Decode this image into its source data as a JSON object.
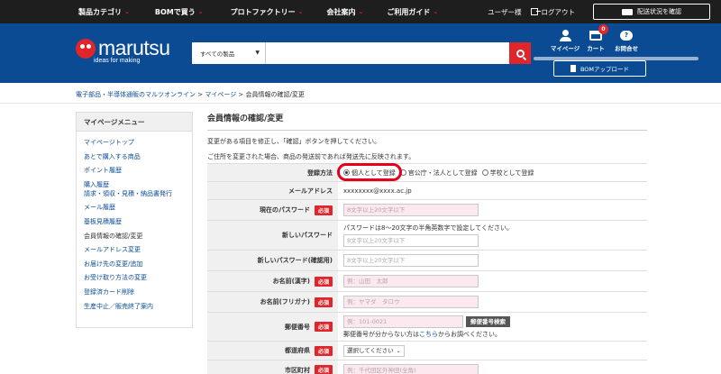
{
  "topbar": {
    "nav": [
      {
        "label": "製品カテゴリ"
      },
      {
        "label": "BOMで買う"
      },
      {
        "label": "プロトファクトリー"
      },
      {
        "label": "会社案内"
      },
      {
        "label": "ご利用ガイド"
      }
    ],
    "user": "ユーザー様",
    "logout": "ログアウト",
    "shipping_button": "配送状況を確認"
  },
  "header": {
    "logo_text": "marutsu",
    "tagline": "ideas for making",
    "search": {
      "category": "すべての製品",
      "query": ""
    },
    "icons": [
      {
        "label": "マイページ",
        "icon": "person-icon"
      },
      {
        "label": "カート",
        "icon": "cart-icon",
        "badge": "0"
      },
      {
        "label": "お問合せ",
        "icon": "chat-icon"
      }
    ],
    "bom_upload": "BOMアップロード"
  },
  "breadcrumb": {
    "home": "電子部品・半導体通販のマルツオンライン",
    "sep": " > ",
    "mypage": "マイページ",
    "current": "会員情報の確認/変更"
  },
  "sidebar": {
    "title": "マイページメニュー",
    "items": [
      {
        "label": "マイページトップ"
      },
      {
        "label": "あとで購入する商品"
      },
      {
        "label": "ポイント履歴"
      },
      {
        "label": "購入履歴",
        "line2": "請求・領収・見積・納品書発行"
      },
      {
        "label": "メール履歴"
      },
      {
        "label": "基板見積履歴"
      },
      {
        "label": "会員情報の確認/変更"
      },
      {
        "label": "メールアドレス変更"
      },
      {
        "label": "お届け先の変更/追加"
      },
      {
        "label": "お受け取り方法の変更"
      },
      {
        "label": "登録済カード削除"
      },
      {
        "label": "生産中止／販売終了案内"
      }
    ]
  },
  "main": {
    "title": "会員情報の確認/変更",
    "intro1": "変更がある項目を修正し、「確認」ボタンを押してください。",
    "intro2": "ご住所を変更された場合、商品の発送前であれば発送先に反映されます。"
  },
  "form": {
    "reg_type": {
      "label": "登録方法",
      "options": [
        "個人として登録",
        "官公庁・法人として登録",
        "学校として登録"
      ],
      "selected": "個人として登録"
    },
    "email": {
      "label": "メールアドレス",
      "value": "xxxxxxxx@xxxx.ac.jp"
    },
    "current_password": {
      "label": "現在のパスワード",
      "required": "必須",
      "placeholder": "8文字以上20文字以下"
    },
    "new_password": {
      "label": "新しいパスワード",
      "note": "パスワードは8〜20文字の半角英数字で設定してください。",
      "placeholder": "8文字以上20文字以下"
    },
    "confirm_password": {
      "label": "新しいパスワード(確認用)",
      "placeholder": "8文字以上20文字以下"
    },
    "name_kanji": {
      "label": "お名前(漢字)",
      "required": "必須",
      "placeholder": "例：山田　太郎"
    },
    "name_kana": {
      "label": "お名前(フリガナ)",
      "required": "必須",
      "placeholder": "例：ヤマダ　タロウ"
    },
    "zip": {
      "label": "郵便番号",
      "required": "必須",
      "placeholder": "例：101-0021",
      "button": "郵便番号検索",
      "note_pre": "郵便番号が分からない方は",
      "note_link": "こちら",
      "note_post": "からお調べください。"
    },
    "prefecture": {
      "label": "都道府県",
      "required": "必須",
      "value": "選択してください"
    },
    "city": {
      "label": "市区町村",
      "required": "必須",
      "placeholder": "例：千代田区外神田(全角)"
    }
  }
}
